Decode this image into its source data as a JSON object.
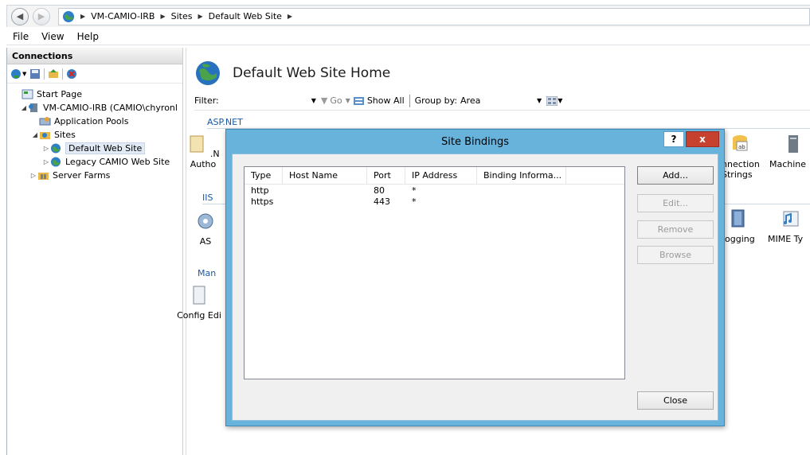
{
  "address": {
    "crumbs": [
      "VM-CAMIO-IRB",
      "Sites",
      "Default Web Site"
    ]
  },
  "menu": [
    "File",
    "View",
    "Help"
  ],
  "connections": {
    "title": "Connections",
    "tree": [
      {
        "label": "Start Page"
      },
      {
        "label": "VM-CAMIO-IRB (CAMIO\\chyronl"
      },
      {
        "label": "Application Pools"
      },
      {
        "label": "Sites"
      },
      {
        "label": "Default Web Site"
      },
      {
        "label": "Legacy CAMIO Web Site"
      },
      {
        "label": "Server Farms"
      }
    ]
  },
  "main": {
    "title": "Default Web Site Home",
    "filter_label": "Filter:",
    "go_label": "Go",
    "show_all_label": "Show All",
    "group_by_label": "Group by:",
    "group_by_value": "Area",
    "groups": [
      "ASP.NET",
      "IIS",
      "Man"
    ],
    "features_left": [
      ".N Autho",
      "AS",
      "Config Edi"
    ],
    "features_right": [
      {
        "line1": "nnection",
        "line2": "Strings"
      },
      {
        "line1": "Machine",
        "line2": ""
      },
      {
        "line1": "ogging",
        "line2": ""
      },
      {
        "line1": "MIME Ty",
        "line2": ""
      }
    ]
  },
  "dialog": {
    "title": "Site Bindings",
    "help_label": "?",
    "close_label": "x",
    "columns": [
      "Type",
      "Host Name",
      "Port",
      "IP Address",
      "Binding Informa..."
    ],
    "rows": [
      {
        "type": "http",
        "host": "",
        "port": "80",
        "ip": "*",
        "binding": ""
      },
      {
        "type": "https",
        "host": "",
        "port": "443",
        "ip": "*",
        "binding": ""
      }
    ],
    "buttons": {
      "add": "Add...",
      "edit": "Edit...",
      "remove": "Remove",
      "browse": "Browse",
      "close": "Close"
    }
  },
  "colors": {
    "dialog_frame": "#68b3dc",
    "close_button": "#c7412f",
    "group_label": "#1a5aa5"
  }
}
